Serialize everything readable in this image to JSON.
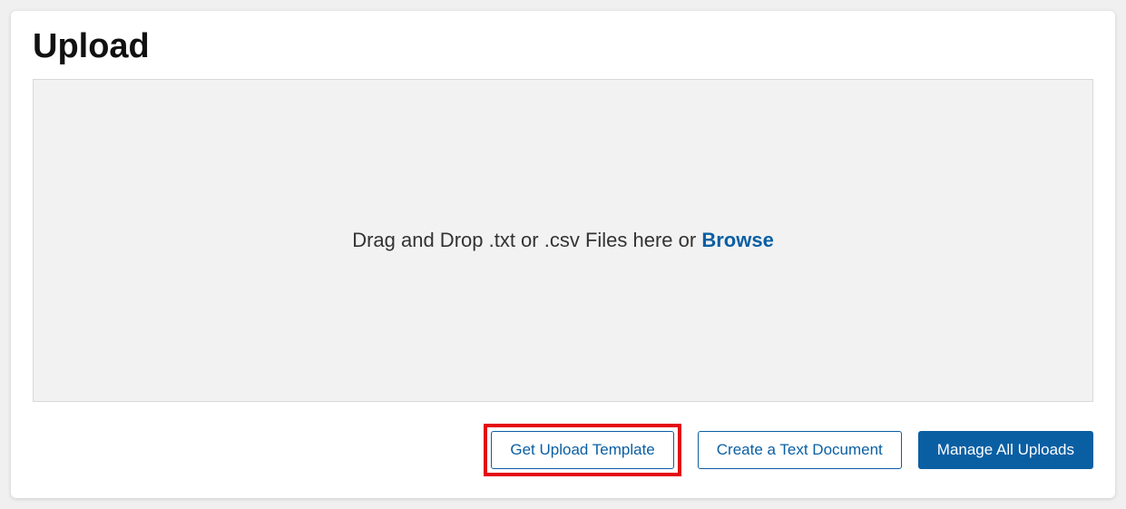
{
  "page": {
    "title": "Upload"
  },
  "dropzone": {
    "text_prefix": "Drag and Drop .txt or .csv Files here or ",
    "browse_label": "Browse"
  },
  "buttons": {
    "get_upload_template": "Get Upload Template",
    "create_text_document": "Create a Text Document",
    "manage_all_uploads": "Manage All Uploads"
  },
  "colors": {
    "accent": "#0a5fa3",
    "highlight": "#e30613",
    "dropzone_bg": "#f2f2f2"
  }
}
